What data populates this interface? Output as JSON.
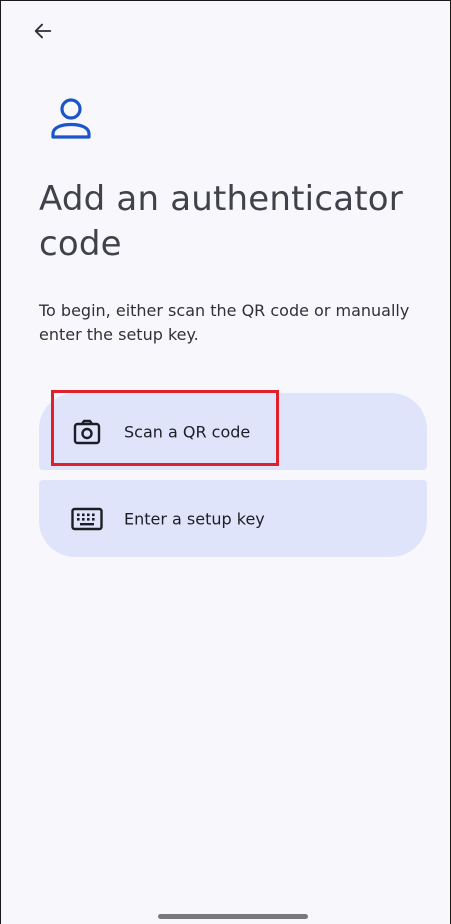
{
  "header": {
    "back_icon": "arrow-left-icon"
  },
  "hero": {
    "icon": "account-icon",
    "accent_color": "#1a56c9"
  },
  "title": "Add an authenticator code",
  "subtitle": "To begin, either scan the QR code or manually enter the setup key.",
  "options": [
    {
      "label": "Scan a QR code",
      "icon": "camera-icon"
    },
    {
      "label": "Enter a setup key",
      "icon": "keyboard-icon"
    }
  ],
  "colors": {
    "background": "#f8f7fc",
    "option_background": "#dfe4fb",
    "highlight": "#e0202a"
  }
}
